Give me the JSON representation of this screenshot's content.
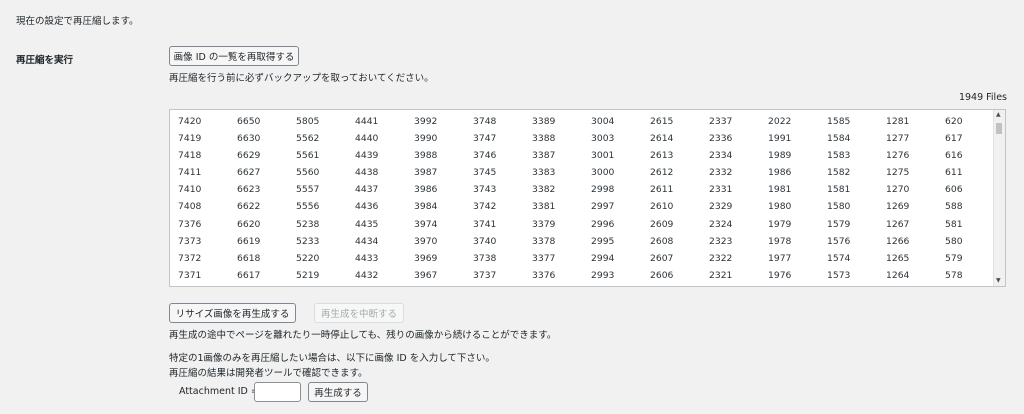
{
  "intro_text": "現在の設定で再圧縮します。",
  "row_label": "再圧縮を実行",
  "refetch_button": "画像 ID の一覧を再取得する",
  "backup_note": "再圧縮を行う前に必ずバックアップを取っておいてください。",
  "files_count": "1949 Files",
  "id_rows": [
    [
      "7420",
      "6650",
      "5805",
      "4441",
      "3992",
      "3748",
      "3389",
      "3004",
      "2615",
      "2337",
      "2022",
      "1585",
      "1281",
      "620"
    ],
    [
      "7419",
      "6630",
      "5562",
      "4440",
      "3990",
      "3747",
      "3388",
      "3003",
      "2614",
      "2336",
      "1991",
      "1584",
      "1277",
      "617"
    ],
    [
      "7418",
      "6629",
      "5561",
      "4439",
      "3988",
      "3746",
      "3387",
      "3001",
      "2613",
      "2334",
      "1989",
      "1583",
      "1276",
      "616"
    ],
    [
      "7411",
      "6627",
      "5560",
      "4438",
      "3987",
      "3745",
      "3383",
      "3000",
      "2612",
      "2332",
      "1986",
      "1582",
      "1275",
      "611"
    ],
    [
      "7410",
      "6623",
      "5557",
      "4437",
      "3986",
      "3743",
      "3382",
      "2998",
      "2611",
      "2331",
      "1981",
      "1581",
      "1270",
      "606"
    ],
    [
      "7408",
      "6622",
      "5556",
      "4436",
      "3984",
      "3742",
      "3381",
      "2997",
      "2610",
      "2329",
      "1980",
      "1580",
      "1269",
      "588"
    ],
    [
      "7376",
      "6620",
      "5238",
      "4435",
      "3974",
      "3741",
      "3379",
      "2996",
      "2609",
      "2324",
      "1979",
      "1579",
      "1267",
      "581"
    ],
    [
      "7373",
      "6619",
      "5233",
      "4434",
      "3970",
      "3740",
      "3378",
      "2995",
      "2608",
      "2323",
      "1978",
      "1576",
      "1266",
      "580"
    ],
    [
      "7372",
      "6618",
      "5220",
      "4433",
      "3969",
      "3738",
      "3377",
      "2994",
      "2607",
      "2322",
      "1977",
      "1574",
      "1265",
      "579"
    ],
    [
      "7371",
      "6617",
      "5219",
      "4432",
      "3967",
      "3737",
      "3376",
      "2993",
      "2606",
      "2321",
      "1976",
      "1573",
      "1264",
      "578"
    ]
  ],
  "regen_button": "リサイズ画像を再生成する",
  "stop_button": "再生成を中断する",
  "resume_note": "再生成の途中でページを離れたり一時停止しても、残りの画像から続けることができます。",
  "single_note_1": "特定の1画像のみを再圧縮したい場合は、以下に画像 ID を入力して下さい。",
  "single_note_2": "再圧縮の結果は開発者ツールで確認できます。",
  "attachment_label": "Attachment ID =",
  "attachment_value": "",
  "regen_single_button": "再生成する"
}
